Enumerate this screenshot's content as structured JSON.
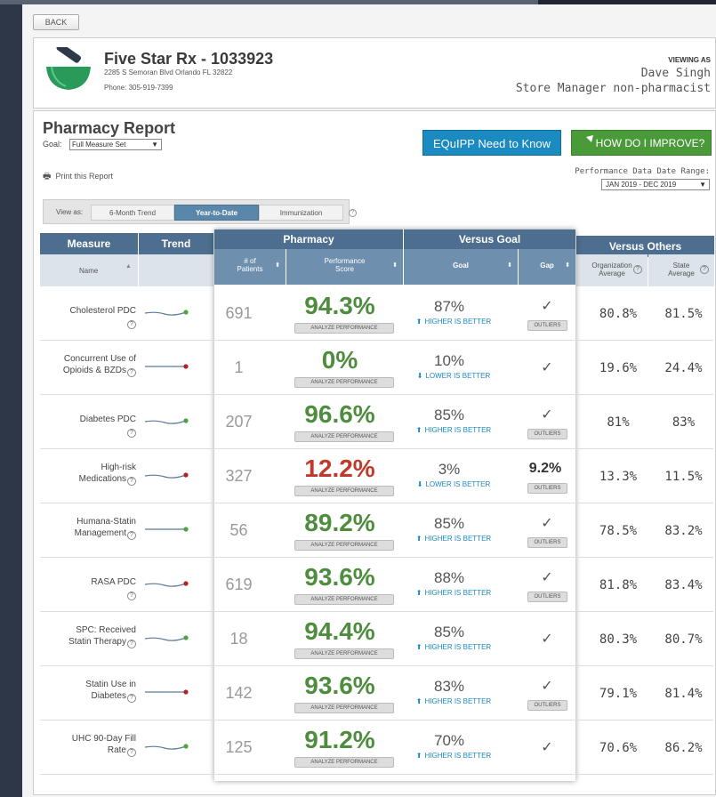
{
  "nav": {
    "back_label": "BACK"
  },
  "store": {
    "name": "Five Star Rx - 1033923",
    "address": "2285 S Semoran Blvd Orlando FL 32822",
    "phone": "Phone: 305-919-7399",
    "viewing_as_label": "VIEWING AS",
    "viewer_name": "Dave Singh",
    "viewer_role": "Store Manager non-pharmacist"
  },
  "report": {
    "title": "Pharmacy Report",
    "goal_label": "Goal:",
    "goal_value": "Full Measure Set",
    "print_label": "Print this Report",
    "equipp_button": "EQuIPP Need to Know",
    "improve_button": "HOW DO I IMPROVE?",
    "date_range_label": "Performance Data Date Range:",
    "date_range_value": "JAN 2019 - DEC 2019",
    "view_as_label": "View as:",
    "view_tabs": [
      "6-Month Trend",
      "Year-to-Date",
      "Immunization"
    ],
    "active_view": "Year-to-Date"
  },
  "table": {
    "headers": {
      "measure": "Measure",
      "trend": "Trend",
      "pharmacy": "Pharmacy",
      "versus_goal": "Versus Goal",
      "versus_others": "Versus Others",
      "name": "Name",
      "patients_1": "# of",
      "patients_2": "Patients",
      "score_1": "Performance",
      "score_2": "Score",
      "goal": "Goal",
      "gap": "Gap",
      "org_1": "Organization",
      "org_2": "Average",
      "state_1": "State",
      "state_2": "Average"
    },
    "analyze_label": "ANALYZE PERFORMANCE",
    "outliers_label": "OUTLIERS",
    "rows": [
      {
        "name_1": "Cholesterol PDC",
        "name_2": "",
        "trend": "green",
        "patients": "691",
        "score": "94.3%",
        "score_status": "good",
        "goal": "87%",
        "direction": "HIGHER IS BETTER",
        "gap": "",
        "outliers": true,
        "org": "80.8%",
        "state": "81.5%"
      },
      {
        "name_1": "Concurrent Use of",
        "name_2": "Opioids & BZDs",
        "trend": "red",
        "patients": "1",
        "score": "0%",
        "score_status": "good",
        "goal": "10%",
        "direction": "LOWER IS BETTER",
        "gap": "",
        "outliers": false,
        "org": "19.6%",
        "state": "24.4%"
      },
      {
        "name_1": "Diabetes PDC",
        "name_2": "",
        "trend": "green",
        "patients": "207",
        "score": "96.6%",
        "score_status": "good",
        "goal": "85%",
        "direction": "HIGHER IS BETTER",
        "gap": "",
        "outliers": true,
        "org": "81%",
        "state": "83%"
      },
      {
        "name_1": "High-risk",
        "name_2": "Medications",
        "trend": "red",
        "patients": "327",
        "score": "12.2%",
        "score_status": "bad",
        "goal": "3%",
        "direction": "LOWER IS BETTER",
        "gap": "9.2%",
        "outliers": true,
        "org": "13.3%",
        "state": "11.5%"
      },
      {
        "name_1": "Humana-Statin",
        "name_2": "Management",
        "trend": "green",
        "patients": "56",
        "score": "89.2%",
        "score_status": "good",
        "goal": "85%",
        "direction": "HIGHER IS BETTER",
        "gap": "",
        "outliers": true,
        "org": "78.5%",
        "state": "83.2%"
      },
      {
        "name_1": "RASA PDC",
        "name_2": "",
        "trend": "red",
        "patients": "619",
        "score": "93.6%",
        "score_status": "good",
        "goal": "88%",
        "direction": "HIGHER IS BETTER",
        "gap": "",
        "outliers": true,
        "org": "81.8%",
        "state": "83.4%"
      },
      {
        "name_1": "SPC: Received",
        "name_2": "Statin Therapy",
        "trend": "green",
        "patients": "18",
        "score": "94.4%",
        "score_status": "good",
        "goal": "85%",
        "direction": "HIGHER IS BETTER",
        "gap": "",
        "outliers": false,
        "org": "80.3%",
        "state": "80.7%"
      },
      {
        "name_1": "Statin Use in",
        "name_2": "Diabetes",
        "trend": "red",
        "patients": "142",
        "score": "93.6%",
        "score_status": "good",
        "goal": "83%",
        "direction": "HIGHER IS BETTER",
        "gap": "",
        "outliers": true,
        "org": "79.1%",
        "state": "81.4%"
      },
      {
        "name_1": "UHC 90-Day Fill",
        "name_2": "Rate",
        "trend": "green",
        "patients": "125",
        "score": "91.2%",
        "score_status": "good",
        "goal": "70%",
        "direction": "HIGHER IS BETTER",
        "gap": "",
        "outliers": false,
        "org": "70.6%",
        "state": "86.2%"
      }
    ]
  },
  "colors": {
    "good": "#4e8d3e",
    "bad": "#c0392b",
    "trend_green": "#4aa63a",
    "trend_red": "#b22222",
    "link_blue": "#1a8ac0"
  }
}
